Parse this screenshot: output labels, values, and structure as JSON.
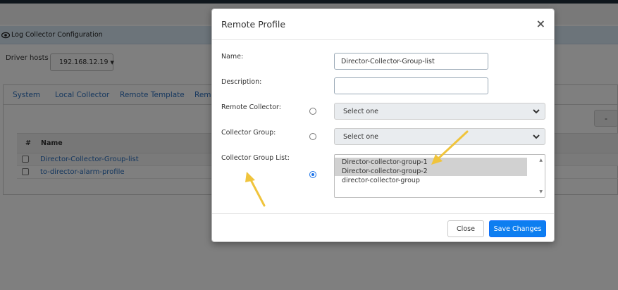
{
  "background": {
    "panel_title": "Log Collector Configuration",
    "driver_hosts_label": "Driver hosts",
    "driver_host_value": "192.168.12.19",
    "tabs": [
      "System",
      "Local Collector",
      "Remote Template",
      "Remo"
    ],
    "dash_button": "-",
    "table": {
      "columns": [
        "#",
        "Name"
      ],
      "rows": [
        {
          "name": "Director-Collector-Group-list"
        },
        {
          "name": "to-director-alarm-profile"
        }
      ]
    }
  },
  "modal": {
    "title": "Remote Profile",
    "close_symbol": "×",
    "name_label": "Name:",
    "name_value": "Director-Collector-Group-list",
    "description_label": "Description:",
    "description_value": "",
    "remote_collector_label": "Remote Collector:",
    "remote_collector_value": "Select one",
    "collector_group_label": "Collector Group:",
    "collector_group_value": "Select one",
    "collector_group_list_label": "Collector Group List:",
    "collector_group_list_options": [
      {
        "label": "Director-collector-group-1",
        "selected": true
      },
      {
        "label": "Director-collector-group-2",
        "selected": true
      },
      {
        "label": "director-collector-group",
        "selected": false
      }
    ],
    "selected_source": "collector_group_list",
    "close_button": "Close",
    "save_button": "Save Changes"
  },
  "colors": {
    "accent": "#0d7ef0",
    "link": "#2a6ebd",
    "annotation_arrow": "#f0c43c"
  }
}
